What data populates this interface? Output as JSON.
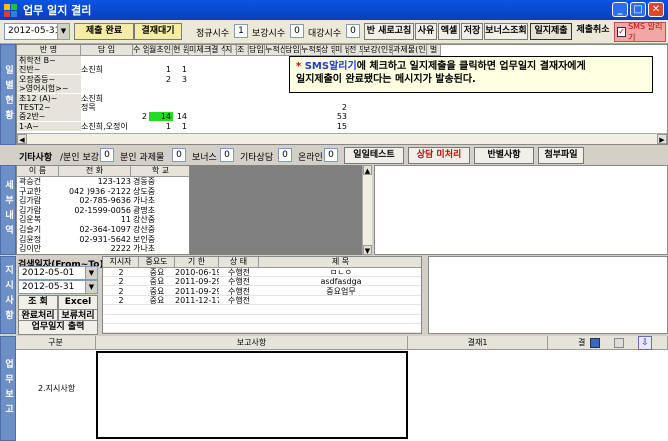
{
  "app": {
    "title": "업무 일지 결리"
  },
  "toolbar": {
    "date": "2012-05-31",
    "status_done": "제출 완료",
    "status_wait": "결재대기",
    "regular_label": "정규시수",
    "regular_value": "1",
    "extra_label": "보강시수",
    "extra_value": "0",
    "substitute_label": "대강시수",
    "substitute_value": "0",
    "refresh": "반 새로고침",
    "reason": "사유",
    "excel": "엑셀",
    "save": "저장",
    "bonus_query": "보너스조회",
    "journal_submit": "일지제출",
    "cancel_submit": "제출취소",
    "sms_label": "SMS 알리기",
    "sms_checked": "✓"
  },
  "class_grid": {
    "side_label": "일별현황",
    "headers": [
      "반 명",
      "담 임",
      "수 업",
      "월초인원",
      "현 원",
      "미체크",
      "결 석",
      "지 각",
      "조 퇴",
      "담임신규",
      "누적신규",
      "담임퇴원",
      "누적퇴원",
      "상 담",
      "미 납",
      "전 도",
      "보강(인원)",
      "과제물(인원)",
      "벌"
    ],
    "rows": [
      [
        "취학전 B~",
        "",
        "",
        "",
        "",
        "",
        "",
        "",
        "",
        "",
        "",
        "",
        "",
        "",
        "",
        "",
        "",
        "",
        ""
      ],
      [
        "진반~",
        "소진희",
        "",
        "1",
        "1",
        "",
        "",
        "",
        "",
        "",
        "",
        "",
        "",
        "",
        "",
        "",
        "",
        "",
        ""
      ],
      [
        "오장중등~",
        "",
        "",
        "2",
        "3",
        "",
        "",
        "",
        "",
        "",
        "",
        "",
        "",
        "",
        "",
        "",
        "",
        "",
        ""
      ],
      [
        ">영어시험>~",
        "",
        "",
        "",
        "",
        "",
        "",
        "",
        "",
        "",
        "",
        "",
        "",
        "",
        "",
        "",
        "",
        "",
        ""
      ],
      [
        "조12 (A)~",
        "소진희",
        "",
        "",
        "",
        "",
        "",
        "",
        "",
        "",
        "",
        "",
        "",
        "",
        "",
        "",
        "",
        "",
        ""
      ],
      [
        "TEST2~",
        "정목",
        "",
        "",
        "",
        "",
        "",
        "",
        "",
        "",
        "",
        "",
        "",
        "",
        "2",
        "",
        "",
        "",
        ""
      ],
      [
        "중2반~",
        "",
        "2",
        "14",
        "14",
        "",
        "",
        "",
        "",
        "",
        "",
        "",
        "",
        "",
        "53",
        "",
        "",
        "",
        ""
      ],
      [
        "1-A~",
        "소진희,오정이",
        "",
        "1",
        "1",
        "",
        "",
        "",
        "",
        "",
        "",
        "",
        "",
        "",
        "15",
        "",
        "",
        "",
        ""
      ]
    ],
    "highlight_value": "14"
  },
  "tooltip": {
    "highlight": "SMS알리기",
    "line1": "에 체크하고 일지제출을 클릭하면 업무일지 결재자에게",
    "line2": "일지제출이 완료됐다는 메시지가 발송된다."
  },
  "etc": {
    "label": "기타사항",
    "supplement_label": "/분인 보강",
    "supplement_value": "0",
    "homework_label": "분인 과제물",
    "homework_value": "0",
    "bonus_label": "보너스",
    "bonus_value": "0",
    "other_label": "기타상담",
    "other_value": "0",
    "online_label": "온라인",
    "online_value": "0",
    "test_button": "일일테스트",
    "counsel_button": "상담 미처리",
    "class_button": "반별사항",
    "attach_button": "첨부파일"
  },
  "students": {
    "side_label": "세부내역",
    "headers": [
      "이 름",
      "전 화",
      "학 교"
    ],
    "rows": [
      [
        "곽승건",
        "123-123",
        "경동중"
      ],
      [
        "구교한",
        "042 )936 -2122",
        "상도중"
      ],
      [
        "김가람",
        "02-785-9636",
        "가나초"
      ],
      [
        "김가람",
        "02-1599-0056",
        "광명초"
      ],
      [
        "김운복",
        "11",
        "강산중"
      ],
      [
        "김슬기",
        "02-364-1097",
        "강산중"
      ],
      [
        "김윤정",
        "02-931-5642",
        "보인중"
      ],
      [
        "김이만",
        "2222",
        "가나초"
      ]
    ]
  },
  "instructions": {
    "side_label": "지시사항",
    "search_label": "검색일자(From~To)",
    "from_date": "2012-05-01",
    "to_date": "2012-05-31",
    "query_button": "조 회",
    "excel_button": "Excel",
    "done_button": "완료처리",
    "hold_button": "보류처리",
    "print_button": "업무일지 출력",
    "headers": [
      "지시자",
      "중요도",
      "기 한",
      "상 태",
      "제 목"
    ],
    "rows": [
      [
        "2",
        "중요",
        "2010-06-19",
        "수행전",
        "ㅁㄴㅇ"
      ],
      [
        "2",
        "중요",
        "2011-09-29",
        "수행전",
        "asdfasdga"
      ],
      [
        "2",
        "중요",
        "2011-09-29",
        "수행전",
        "중요업무"
      ],
      [
        "2",
        "중요",
        "2011-12-17",
        "수행전",
        ""
      ]
    ]
  },
  "report": {
    "side_label": "업무보고",
    "col_type": "구분",
    "col_report": "보고사항",
    "col_approval1": "결재1",
    "col_approval2": "결",
    "row_label": "2.지시사항"
  }
}
